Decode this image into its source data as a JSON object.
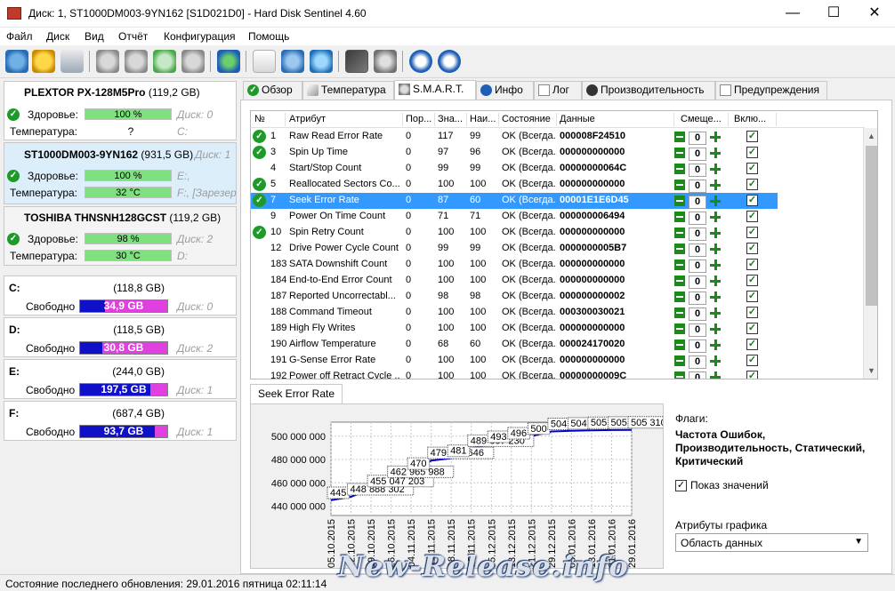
{
  "window": {
    "title": "Диск: 1, ST1000DM003-9YN162 [S1D021D0]  -  Hard Disk Sentinel 4.60"
  },
  "menu": [
    "Файл",
    "Диск",
    "Вид",
    "Отчёт",
    "Конфигурация",
    "Помощь"
  ],
  "disks": [
    {
      "name": "PLEXTOR PX-128M5Pro",
      "size": "(119,2 GB)",
      "health_label": "Здоровье:",
      "health": "100 %",
      "health_frac": 1.0,
      "disk_no": "Диск: 0",
      "temp_label": "Температура:",
      "temp": "?",
      "drives": "C:"
    },
    {
      "name": "ST1000DM003-9YN162",
      "size": "(931,5 GB)",
      "health_label": "Здоровье:",
      "health": "100 %",
      "health_frac": 1.0,
      "disk_no": "Диск: 1",
      "temp_label": "Температура:",
      "temp": "32 °C",
      "drives": "E:,",
      "drives2": "F:, [Зарезер"
    },
    {
      "name": "TOSHIBA THNSNH128GCST",
      "size": "(119,2 GB)",
      "health_label": "Здоровье:",
      "health": "98 %",
      "health_frac": 0.98,
      "disk_no": "Диск: 2",
      "temp_label": "Температура:",
      "temp": "30 °C",
      "drives": "D:"
    }
  ],
  "volumes": [
    {
      "letter": "C:",
      "size": "(118,8 GB)",
      "free_label": "Свободно",
      "free": "34,9 GB",
      "used_frac": 0.29,
      "disk_no": "Диск: 0"
    },
    {
      "letter": "D:",
      "size": "(118,5 GB)",
      "free_label": "Свободно",
      "free": "30,8 GB",
      "used_frac": 0.26,
      "disk_no": "Диск: 2"
    },
    {
      "letter": "E:",
      "size": "(244,0 GB)",
      "free_label": "Свободно",
      "free": "197,5 GB",
      "used_frac": 0.81,
      "disk_no": "Диск: 1"
    },
    {
      "letter": "F:",
      "size": "(687,4 GB)",
      "free_label": "Свободно",
      "free": "93,7 GB",
      "used_frac": 0.86,
      "disk_no": "Диск: 1"
    }
  ],
  "tabs": [
    "Обзор",
    "Температура",
    "S.M.A.R.T.",
    "Инфо",
    "Лог",
    "Производительность",
    "Предупреждения"
  ],
  "smart": {
    "headers": [
      "№",
      "Атрибут",
      "Пор...",
      "Зна...",
      "Наи...",
      "Состояние",
      "Данные",
      "Смеще...",
      "Вклю..."
    ],
    "rows": [
      {
        "no": "1",
        "attr": "Raw Read Error Rate",
        "thr": "0",
        "val": "117",
        "worst": "99",
        "status": "OK (Всегда...",
        "data": "000008F24510",
        "offset": "0",
        "ok": true
      },
      {
        "no": "3",
        "attr": "Spin Up Time",
        "thr": "0",
        "val": "97",
        "worst": "96",
        "status": "OK (Всегда...",
        "data": "000000000000",
        "offset": "0",
        "ok": true
      },
      {
        "no": "4",
        "attr": "Start/Stop Count",
        "thr": "0",
        "val": "99",
        "worst": "99",
        "status": "OK (Всегда...",
        "data": "00000000064C",
        "offset": "0",
        "ok": false
      },
      {
        "no": "5",
        "attr": "Reallocated Sectors Co...",
        "thr": "0",
        "val": "100",
        "worst": "100",
        "status": "OK (Всегда...",
        "data": "000000000000",
        "offset": "0",
        "ok": true
      },
      {
        "no": "7",
        "attr": "Seek Error Rate",
        "thr": "0",
        "val": "87",
        "worst": "60",
        "status": "OK (Всегда...",
        "data": "00001E1E6D45",
        "offset": "0",
        "ok": true,
        "selected": true
      },
      {
        "no": "9",
        "attr": "Power On Time Count",
        "thr": "0",
        "val": "71",
        "worst": "71",
        "status": "OK (Всегда...",
        "data": "000000006494",
        "offset": "0",
        "ok": false
      },
      {
        "no": "10",
        "attr": "Spin Retry Count",
        "thr": "0",
        "val": "100",
        "worst": "100",
        "status": "OK (Всегда...",
        "data": "000000000000",
        "offset": "0",
        "ok": true
      },
      {
        "no": "12",
        "attr": "Drive Power Cycle Count",
        "thr": "0",
        "val": "99",
        "worst": "99",
        "status": "OK (Всегда...",
        "data": "0000000005B7",
        "offset": "0",
        "ok": false
      },
      {
        "no": "183",
        "attr": "SATA Downshift Count",
        "thr": "0",
        "val": "100",
        "worst": "100",
        "status": "OK (Всегда...",
        "data": "000000000000",
        "offset": "0",
        "ok": false
      },
      {
        "no": "184",
        "attr": "End-to-End Error Count",
        "thr": "0",
        "val": "100",
        "worst": "100",
        "status": "OK (Всегда...",
        "data": "000000000000",
        "offset": "0",
        "ok": false
      },
      {
        "no": "187",
        "attr": "Reported Uncorrectabl...",
        "thr": "0",
        "val": "98",
        "worst": "98",
        "status": "OK (Всегда...",
        "data": "000000000002",
        "offset": "0",
        "ok": false
      },
      {
        "no": "188",
        "attr": "Command Timeout",
        "thr": "0",
        "val": "100",
        "worst": "100",
        "status": "OK (Всегда...",
        "data": "000300030021",
        "offset": "0",
        "ok": false
      },
      {
        "no": "189",
        "attr": "High Fly Writes",
        "thr": "0",
        "val": "100",
        "worst": "100",
        "status": "OK (Всегда...",
        "data": "000000000000",
        "offset": "0",
        "ok": false
      },
      {
        "no": "190",
        "attr": "Airflow Temperature",
        "thr": "0",
        "val": "68",
        "worst": "60",
        "status": "OK (Всегда...",
        "data": "000024170020",
        "offset": "0",
        "ok": false
      },
      {
        "no": "191",
        "attr": "G-Sense Error Rate",
        "thr": "0",
        "val": "100",
        "worst": "100",
        "status": "OK (Всегда...",
        "data": "000000000000",
        "offset": "0",
        "ok": false
      },
      {
        "no": "192",
        "attr": "Power off Retract Cycle ...",
        "thr": "0",
        "val": "100",
        "worst": "100",
        "status": "OK (Всегда...",
        "data": "00000000009C",
        "offset": "0",
        "ok": false
      }
    ]
  },
  "chart_tab": "Seek Error Rate",
  "chart_data": {
    "type": "line",
    "x": [
      "05.10.2015",
      "12.10.2015",
      "19.10.2015",
      "26.10.2015",
      "04.11.2015",
      "11.11.2015",
      "18.11.2015",
      "25.11.2015",
      "05.12.2015",
      "13.12.2015",
      "21.12.2015",
      "29.12.2015",
      "05.01.2016",
      "13.01.2016",
      "21.01.2016",
      "29.01.2016"
    ],
    "y": [
      445000000,
      448000000,
      455047203,
      462965988,
      470000000,
      479112646,
      481000000,
      489607230,
      493000000,
      496000000,
      500000000,
      504000000,
      504500000,
      505000000,
      505200000,
      505310533
    ],
    "point_labels": [
      "445",
      "448 888 302",
      "455 047 203",
      "462 965 988",
      "470",
      "479 112 646",
      "481",
      "489 607 230",
      "493",
      "496",
      "500",
      "504",
      "504",
      "505",
      "505",
      "505 310 533"
    ],
    "yticks": [
      "440 000 000",
      "460 000 000",
      "480 000 000",
      "500 000 000"
    ],
    "ytick_values": [
      440000000,
      460000000,
      480000000,
      500000000
    ],
    "ylim": [
      432000000,
      512000000
    ],
    "grid": true,
    "series_color": "#0000cc"
  },
  "flags": {
    "title": "Флаги:",
    "text": "Частота Ошибок, Производительность, Статический, Критический"
  },
  "show_values": {
    "label": "Показ значений",
    "checked": true
  },
  "chart_attrs": {
    "label": "Атрибуты графика",
    "value": "Область данных"
  },
  "status": "Состояние последнего обновления: 29.01.2016 пятница 02:11:14",
  "watermark": "New-Release.info"
}
